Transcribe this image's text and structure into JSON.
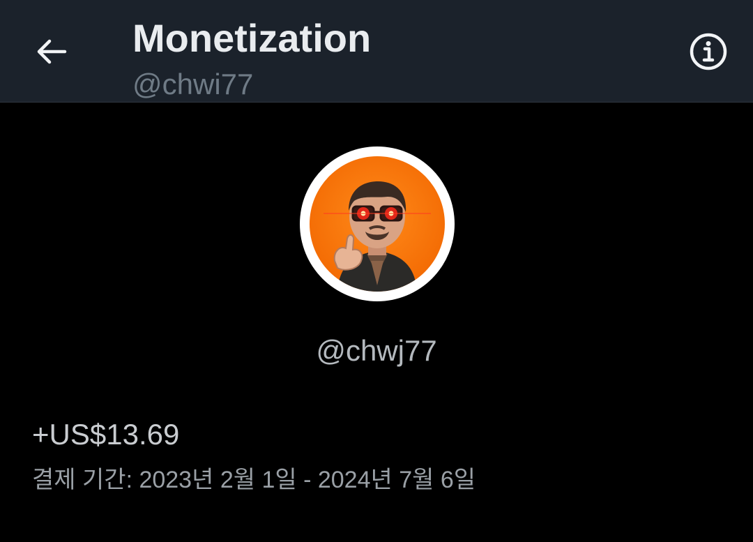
{
  "header": {
    "title": "Monetization",
    "subtitle": "@chwi77",
    "back_icon": "arrow-left-icon",
    "info_icon": "info-circle-icon"
  },
  "profile": {
    "avatar": "user-avatar-cartoon",
    "handle": "@chwj77"
  },
  "earnings": {
    "amount": "+US$13.69",
    "period": "결제 기간: 2023년 2월 1일 - 2024년 7월 6일"
  },
  "colors": {
    "header_bg": "#1b222b",
    "page_bg": "#000000",
    "avatar_bg": "#f46d05"
  }
}
